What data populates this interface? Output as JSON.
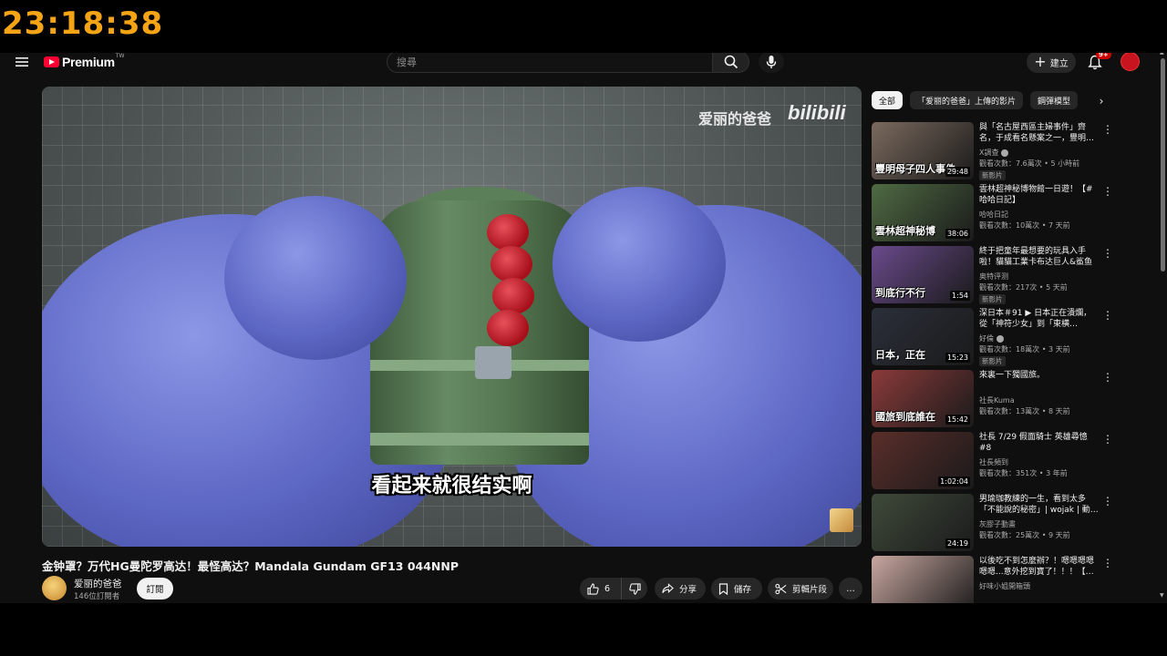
{
  "clock": "23:18:38",
  "header": {
    "logo_text": "Premium",
    "logo_tm": "TW",
    "search_placeholder": "搜尋",
    "create_label": "建立",
    "notifications_badge": "9+"
  },
  "player": {
    "watermark_text": "爱丽的爸爸",
    "watermark_logo": "bilibili",
    "subtitle": "看起来就很结实啊"
  },
  "video": {
    "title": "金钟罩？万代HG曼陀罗高达！最怪高达？Mandala Gundam GF13 044NNP",
    "channel_name": "爱丽的爸爸",
    "channel_subs": "146位訂閱者",
    "subscribe_label": "訂閱",
    "like_count": "6",
    "share_label": "分享",
    "save_label": "儲存",
    "clip_label": "剪輯片段",
    "more_label": "…"
  },
  "sidebar": {
    "chips": [
      "全部",
      "「爱丽的爸爸」上傳的影片",
      "鋼彈模型"
    ],
    "chip_next": "›",
    "recommendations": [
      {
        "title": "與「名古屋西區主婦事件」齊名，于成看名懸案之一，豐明…",
        "channel": "X調查",
        "verified": true,
        "meta": "觀看次數：7.6萬次 • 5 小時前",
        "badge": "新影片",
        "duration": "29:48",
        "overlay": "豐明母子四人事件",
        "thumb_color": "#7b6a5e"
      },
      {
        "title": "雲林超神秘博物館一日遊！【# 哈哈日記】",
        "channel": "哈哈日記",
        "verified": false,
        "meta": "觀看次數：10萬次 • 7 天前",
        "badge": "",
        "duration": "38:06",
        "overlay": "雲林超神秘博",
        "thumb_color": "#4f6b43"
      },
      {
        "title": "終于把童年最想要的玩具入手啦！貓貓工業卡布达巨人&鯊鱼巨…",
        "channel": "奥特评测",
        "verified": false,
        "meta": "觀看次數：217次 • 5 天前",
        "badge": "新影片",
        "duration": "1:54",
        "overlay": "到底行不行",
        "thumb_color": "#6a4a8c"
      },
      {
        "title": "深日本＃91 ▶ 日本正在潰爛，從「神符少女」到「東横…",
        "channel": "好倫",
        "verified": true,
        "meta": "觀看次數：18萬次 • 3 天前",
        "badge": "新影片",
        "duration": "15:23",
        "overlay": "日本，正在",
        "thumb_color": "#2b2f3a"
      },
      {
        "title": "來裏一下獨國旅。",
        "channel": "社長Kuma",
        "verified": false,
        "meta": "觀看次數：13萬次 • 8 天前",
        "badge": "",
        "duration": "15:42",
        "overlay": "國旅到底誰在",
        "thumb_color": "#8b3a3a"
      },
      {
        "title": "社長 7/29 假面騎士 英雄尋憶 #8",
        "channel": "社長頻到",
        "verified": false,
        "meta": "觀看次數：351次 • 3 年前",
        "badge": "",
        "duration": "1:02:04",
        "overlay": "",
        "thumb_color": "#5a2e2a"
      },
      {
        "title": "男瑜珈教練的一生，看到太多「不能說的秘密」| wojak | 動…",
        "channel": "灰膠子動畫",
        "verified": false,
        "meta": "觀看次數：25萬次 • 9 天前",
        "badge": "",
        "duration": "24:19",
        "overlay": "",
        "thumb_color": "#3f4a3a"
      },
      {
        "title": "以後吃不到怎麼辦？！嗯嗯嗯嗯嗯嗯...意外挖到寶了！！！【…",
        "channel": "好味小姐開箱頭",
        "verified": false,
        "meta": "",
        "badge": "",
        "duration": "",
        "overlay": "",
        "thumb_color": "#c9a7a0"
      }
    ]
  },
  "colors": {
    "clock": "#f5a416",
    "brand_red": "#ff0033",
    "page_bg": "#0f0f0f"
  },
  "icons": {
    "menu": "hamburger-icon",
    "search": "search-icon",
    "mic": "mic-icon",
    "create": "plus-icon",
    "bell": "bell-icon",
    "like": "thumbs-up-icon",
    "dislike": "thumbs-down-icon",
    "share": "share-icon",
    "save": "bookmark-icon",
    "clip": "scissors-icon",
    "kebab": "kebab-icon"
  }
}
